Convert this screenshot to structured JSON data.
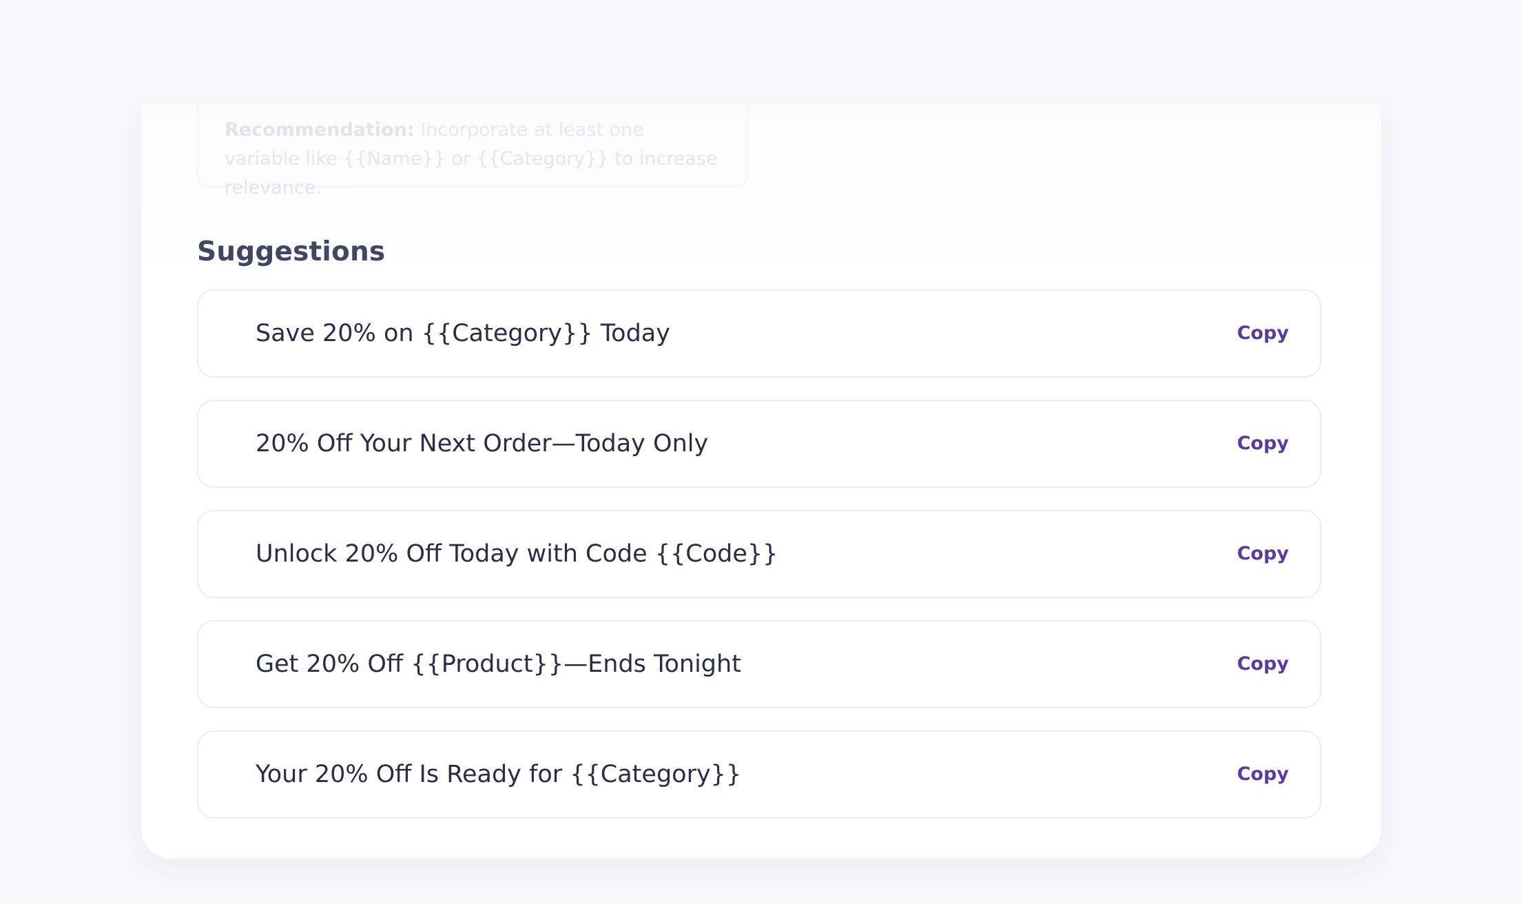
{
  "recommendation": {
    "label": "Recommendation:",
    "text": "Incorporate at least one variable like {{Name}} or {{Category}} to increase relevance."
  },
  "suggestions": {
    "title": "Suggestions",
    "copy_label": "Copy",
    "items": [
      {
        "text": "Save 20% on {{Category}} Today"
      },
      {
        "text": "20% Off Your Next Order—Today Only"
      },
      {
        "text": "Unlock 20% Off Today with Code {{Code}}"
      },
      {
        "text": "Get 20% Off {{Product}}—Ends Tonight"
      },
      {
        "text": "Your 20% Off Is Ready for {{Category}}"
      }
    ]
  },
  "colors": {
    "page_bg": "#f7f8fa",
    "card_bg": "#ffffff",
    "title": "#414661",
    "text": "#2a2e45",
    "accent": "#5a3d9b",
    "border": "#eceef2"
  }
}
